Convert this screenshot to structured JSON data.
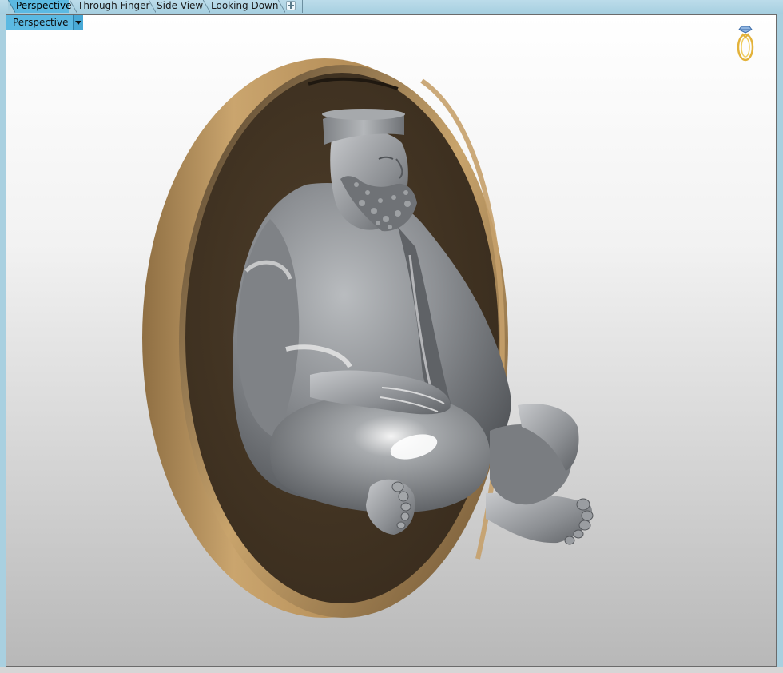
{
  "tabs": [
    {
      "label": "Perspective",
      "active": true
    },
    {
      "label": "Through Finger",
      "active": false
    },
    {
      "label": "Side View",
      "active": false
    },
    {
      "label": "Looking Down",
      "active": false
    }
  ],
  "add_tab_icon": "plus-icon",
  "viewport": {
    "view_mode": "Perspective",
    "dropdown_icon": "chevron-down-icon",
    "corner_icon": "ring-icon"
  },
  "colors": {
    "accent": "#5bb9e2",
    "tabbar": "#a6cfe0",
    "pendant_gold": "#c19b63",
    "pendant_dark": "#463826",
    "model_gray": "#8a8d91"
  }
}
